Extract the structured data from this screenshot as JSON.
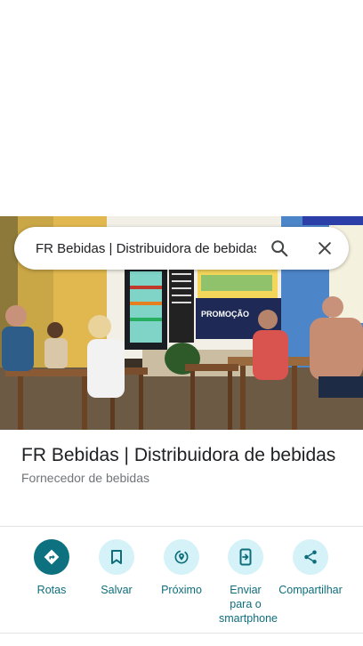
{
  "search": {
    "query": "FR Bebidas | Distribuidora de bebidas"
  },
  "place": {
    "title": "FR Bebidas | Distribuidora de bebidas",
    "category": "Fornecedor de bebidas"
  },
  "photo": {
    "sign_text": "PROMOÇÃO"
  },
  "actions": [
    {
      "label": "Rotas",
      "icon": "directions-icon"
    },
    {
      "label": "Salvar",
      "icon": "bookmark-icon"
    },
    {
      "label": "Próximo",
      "icon": "nearby-icon"
    },
    {
      "label": "Enviar para o smartphone",
      "icon": "send-to-phone-icon"
    },
    {
      "label": "Compartilhar",
      "icon": "share-icon"
    }
  ],
  "colors": {
    "accent": "#0e7180",
    "action_bg": "#d4f2f7",
    "label": "#0e6e7c"
  }
}
